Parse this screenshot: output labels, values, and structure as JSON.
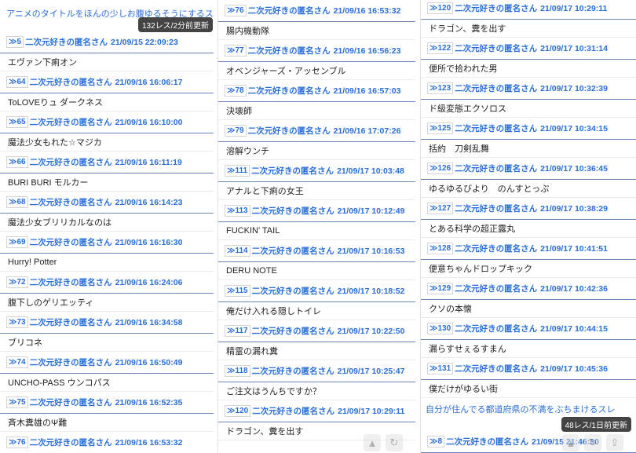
{
  "col1": {
    "thread_title": "アニメのタイトルをほんの少しお腹ゆるそうにするスレ",
    "res_count": "132レス/2分前更新",
    "posts": [
      {
        "num": "5",
        "name": "二次元好きの匿名さん",
        "date": "21/09/15 22:09:23",
        "body": "エヴァン下痢オン"
      },
      {
        "num": "64",
        "name": "二次元好きの匿名さん",
        "date": "21/09/16 16:06:17",
        "body": "ToLOVEりュ ダークネス"
      },
      {
        "num": "65",
        "name": "二次元好きの匿名さん",
        "date": "21/09/16 16:10:00",
        "body": "魔法少女もれた☆マジカ"
      },
      {
        "num": "66",
        "name": "二次元好きの匿名さん",
        "date": "21/09/16 16:11:19",
        "body": "BURI BURI モルカー"
      },
      {
        "num": "68",
        "name": "二次元好きの匿名さん",
        "date": "21/09/16 16:14:23",
        "body": "魔法少女ブリリカルなのは"
      },
      {
        "num": "69",
        "name": "二次元好きの匿名さん",
        "date": "21/09/16 16:16:30",
        "body": "Hurry! Potter"
      },
      {
        "num": "72",
        "name": "二次元好きの匿名さん",
        "date": "21/09/16 16:24:06",
        "body": "腹下しのゲリエッティ"
      },
      {
        "num": "73",
        "name": "二次元好きの匿名さん",
        "date": "21/09/16 16:34:58",
        "body": "ブリコネ"
      },
      {
        "num": "74",
        "name": "二次元好きの匿名さん",
        "date": "21/09/16 16:50:49",
        "body": "UNCHO-PASS ウンコパス"
      },
      {
        "num": "75",
        "name": "二次元好きの匿名さん",
        "date": "21/09/16 16:52:35",
        "body": "斉木糞雄のΨ難"
      },
      {
        "num": "76",
        "name": "二次元好きの匿名さん",
        "date": "21/09/16 16:53:32",
        "body": ""
      }
    ]
  },
  "col2": {
    "posts": [
      {
        "num": "76",
        "name": "二次元好きの匿名さん",
        "date": "21/09/16 16:53:32",
        "body": "腸内機動隊"
      },
      {
        "num": "77",
        "name": "二次元好きの匿名さん",
        "date": "21/09/16 16:56:23",
        "body": "オベンジャーズ・アッセンブル"
      },
      {
        "num": "78",
        "name": "二次元好きの匿名さん",
        "date": "21/09/16 16:57:03",
        "body": "決壊師"
      },
      {
        "num": "79",
        "name": "二次元好きの匿名さん",
        "date": "21/09/16 17:07:26",
        "body": "溶解ウンチ"
      },
      {
        "num": "111",
        "name": "二次元好きの匿名さん",
        "date": "21/09/17 10:03:48",
        "body": "アナルと下痢の女王"
      },
      {
        "num": "113",
        "name": "二次元好きの匿名さん",
        "date": "21/09/17 10:12:49",
        "body": "FUCKIN' TAIL"
      },
      {
        "num": "114",
        "name": "二次元好きの匿名さん",
        "date": "21/09/17 10:16:53",
        "body": "DERU NOTE"
      },
      {
        "num": "115",
        "name": "二次元好きの匿名さん",
        "date": "21/09/17 10:18:52",
        "body": "俺だけ入れる隠しトイレ"
      },
      {
        "num": "117",
        "name": "二次元好きの匿名さん",
        "date": "21/09/17 10:22:50",
        "body": "精霊の漏れ糞"
      },
      {
        "num": "118",
        "name": "二次元好きの匿名さん",
        "date": "21/09/17 10:25:47",
        "body": "ご注文はうんちですか？"
      },
      {
        "num": "120",
        "name": "二次元好きの匿名さん",
        "date": "21/09/17 10:29:11",
        "body": "ドラゴン、糞を出す"
      }
    ]
  },
  "col3": {
    "posts": [
      {
        "num": "120",
        "name": "二次元好きの匿名さん",
        "date": "21/09/17 10:29:11",
        "body": "ドラゴン、糞を出す"
      },
      {
        "num": "122",
        "name": "二次元好きの匿名さん",
        "date": "21/09/17 10:31:14",
        "body": "便所で拾われた男"
      },
      {
        "num": "123",
        "name": "二次元好きの匿名さん",
        "date": "21/09/17 10:32:39",
        "body": "ド級変態エクソロス"
      },
      {
        "num": "125",
        "name": "二次元好きの匿名さん",
        "date": "21/09/17 10:34:15",
        "body": "括約　刀剣乱舞"
      },
      {
        "num": "126",
        "name": "二次元好きの匿名さん",
        "date": "21/09/17 10:36:45",
        "body": "ゆるゆるびより　のんすとっぷ"
      },
      {
        "num": "127",
        "name": "二次元好きの匿名さん",
        "date": "21/09/17 10:38:29",
        "body": "とある科学の超正露丸"
      },
      {
        "num": "128",
        "name": "二次元好きの匿名さん",
        "date": "21/09/17 10:41:51",
        "body": "便意ちゃんドロップキック"
      },
      {
        "num": "129",
        "name": "二次元好きの匿名さん",
        "date": "21/09/17 10:42:36",
        "body": "クソの本懐"
      },
      {
        "num": "130",
        "name": "二次元好きの匿名さん",
        "date": "21/09/17 10:44:15",
        "body": "漏らすせぇるすまん"
      },
      {
        "num": "131",
        "name": "二次元好きの匿名さん",
        "date": "21/09/17 10:45:36",
        "body": "僕だけがゆるい街"
      }
    ],
    "next_thread_title": "自分が住んでる都道府県の不満をぶちまけるスレ",
    "next_res_count": "48レス/1日前更新",
    "next_first_post": {
      "num": "8",
      "name": "二次元好きの匿名さん",
      "date": "21/09/15 21:46:30"
    }
  },
  "colors": {
    "link": "#2a6fd6",
    "divider": "#6b86b8",
    "badge_bg": "#444444"
  }
}
